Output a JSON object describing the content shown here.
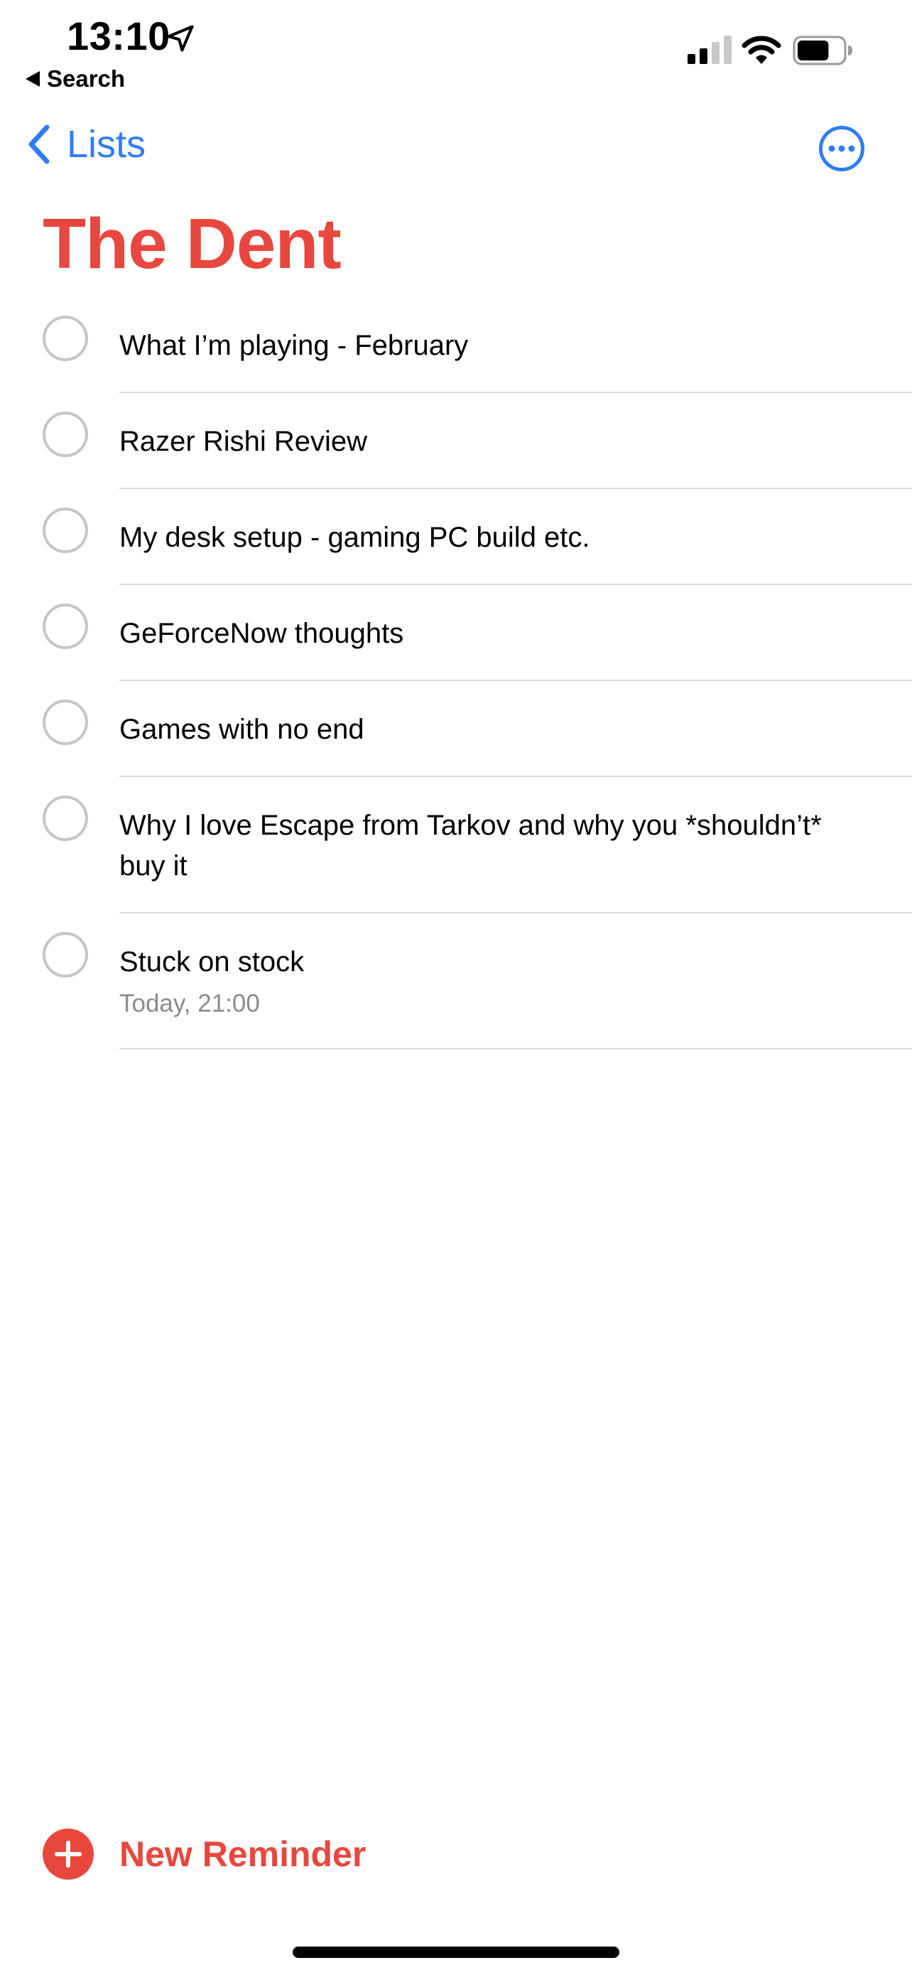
{
  "status_bar": {
    "time": "13:10",
    "back_app_label": "Search",
    "location_icon": "location-arrow-icon",
    "signal_icon": "cellular-signal-icon",
    "wifi_icon": "wifi-icon",
    "battery_icon": "battery-icon",
    "battery_level": 0.7
  },
  "nav": {
    "back_label": "Lists",
    "more_icon": "ellipsis-circle-icon"
  },
  "list_title": "The Dent",
  "reminders": [
    {
      "title": "What I’m playing - February",
      "detail": ""
    },
    {
      "title": "Razer Rishi Review",
      "detail": ""
    },
    {
      "title": "My desk setup - gaming PC build etc.",
      "detail": ""
    },
    {
      "title": "GeForceNow thoughts",
      "detail": ""
    },
    {
      "title": "Games with no end",
      "detail": ""
    },
    {
      "title": "Why I love Escape from Tarkov and why you *shouldn’t* buy it",
      "detail": ""
    },
    {
      "title": "Stuck on stock",
      "detail": "Today, 21:00"
    }
  ],
  "footer": {
    "new_reminder_label": "New Reminder"
  },
  "colors": {
    "accent_red": "#e8473e",
    "link_blue": "#2f7df6",
    "secondary_text": "#8a8a8e"
  }
}
